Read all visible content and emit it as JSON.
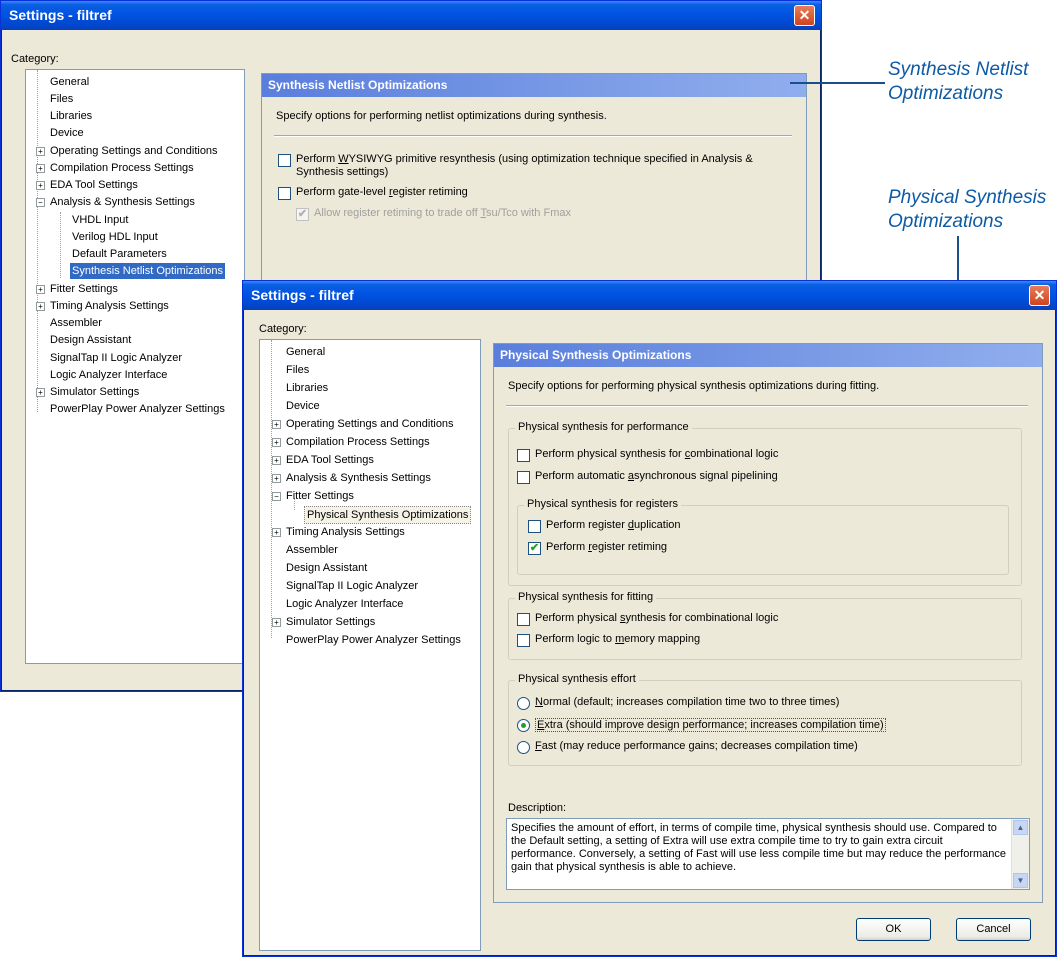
{
  "back_window": {
    "title": "Settings - filtref",
    "close_glyph": "✕",
    "category_label": "Category:",
    "tree": [
      "General",
      "Files",
      "Libraries",
      "Device",
      "Operating Settings and Conditions",
      "Compilation Process Settings",
      "EDA Tool Settings",
      "Analysis & Synthesis Settings",
      "VHDL Input",
      "Verilog HDL Input",
      "Default Parameters",
      "Synthesis Netlist Optimizations",
      "Fitter Settings",
      "Timing Analysis Settings",
      "Assembler",
      "Design Assistant",
      "SignalTap II Logic Analyzer",
      "Logic Analyzer Interface",
      "Simulator Settings",
      "PowerPlay Power Analyzer Settings"
    ],
    "panel_title": "Synthesis Netlist Optimizations",
    "panel_desc": "Specify options for performing netlist optimizations during synthesis.",
    "opt1_line1_pre": "Perform ",
    "opt1_line1_u": "W",
    "opt1_line1_post": "YSIWYG primitive resynthesis (using optimization technique specified in Analysis &",
    "opt1_line2": "Synthesis settings)",
    "opt2_pre": "Perform gate-level ",
    "opt2_u": "r",
    "opt2_post": "egister retiming",
    "opt3_pre": "Allow register retiming to trade off ",
    "opt3_u": "T",
    "opt3_post": "su/Tco with Fmax"
  },
  "front_window": {
    "title": "Settings - filtref",
    "close_glyph": "✕",
    "category_label": "Category:",
    "tree": [
      "General",
      "Files",
      "Libraries",
      "Device",
      "Operating Settings and Conditions",
      "Compilation Process Settings",
      "EDA Tool Settings",
      "Analysis & Synthesis Settings",
      "Fitter Settings",
      "Physical Synthesis Optimizations",
      "Timing Analysis Settings",
      "Assembler",
      "Design Assistant",
      "SignalTap II Logic Analyzer",
      "Logic Analyzer Interface",
      "Simulator Settings",
      "PowerPlay Power Analyzer Settings"
    ],
    "panel_title": "Physical Synthesis Optimizations",
    "panel_desc": "Specify options for performing physical synthesis optimizations during fitting.",
    "group_perf": "Physical synthesis for performance",
    "perf_opt1_pre": "Perform physical synthesis for ",
    "perf_opt1_u": "c",
    "perf_opt1_post": "ombinational logic",
    "perf_opt2_pre": "Perform automatic ",
    "perf_opt2_u": "a",
    "perf_opt2_post": "synchronous signal pipelining",
    "group_regs": "Physical synthesis for registers",
    "reg_opt1_pre": "Perform register ",
    "reg_opt1_u": "d",
    "reg_opt1_post": "uplication",
    "reg_opt2_pre": "Perform ",
    "reg_opt2_u": "r",
    "reg_opt2_post": "egister retiming",
    "group_fit": "Physical synthesis for fitting",
    "fit_opt1_pre": "Perform physical ",
    "fit_opt1_u": "s",
    "fit_opt1_post": "ynthesis for combinational logic",
    "fit_opt2_pre": "Perform logic to ",
    "fit_opt2_u": "m",
    "fit_opt2_post": "emory mapping",
    "group_effort": "Physical synthesis effort",
    "effort_normal_u": "N",
    "effort_normal_post": "ormal (default; increases compilation time two to three times)",
    "effort_extra_u": "E",
    "effort_extra_post": "xtra (should improve design performance; increases compilation time)",
    "effort_fast_u": "F",
    "effort_fast_post": "ast (may reduce performance gains; decreases compilation time)",
    "description_label": "Description:",
    "description_text": "Specifies the amount of effort, in terms of compile time, physical synthesis should use. Compared to the Default setting, a setting of Extra will use extra compile time to try to gain extra circuit performance.  Conversely, a setting of Fast will use less compile time but may reduce the performance gain that physical synthesis is able to achieve.",
    "ok_label": "OK",
    "cancel_label": "Cancel"
  },
  "callouts": {
    "netlist_line1": "Synthesis Netlist",
    "netlist_line2": "Optimizations",
    "physical_line1": "Physical Synthesis",
    "physical_line2": "Optimizations"
  },
  "state": {
    "back_wysiwyg_checked": false,
    "back_retiming_checked": false,
    "back_allow_tradeoff_checked": true,
    "perf_combinational_checked": false,
    "perf_async_pipelining_checked": false,
    "reg_duplication_checked": false,
    "reg_retiming_checked": true,
    "fit_combinational_checked": false,
    "fit_memory_mapping_checked": false,
    "effort_selected": "Extra"
  },
  "icons": {
    "check": "✔",
    "plus": "+",
    "minus": "−",
    "scroll_up": "▲",
    "scroll_down": "▼"
  }
}
